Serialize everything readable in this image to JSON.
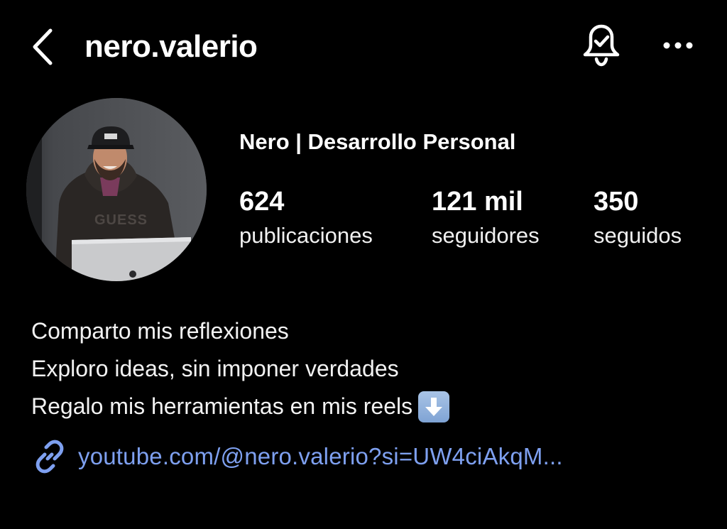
{
  "header": {
    "username": "nero.valerio",
    "back_icon": "chevron-left-icon",
    "bell_icon": "bell-check-icon",
    "more_icon": "more-horizontal-icon"
  },
  "profile": {
    "display_name": "Nero | Desarrollo Personal",
    "avatar_icon": "profile-avatar"
  },
  "stats": [
    {
      "value": "624",
      "label": "publicaciones"
    },
    {
      "value": "121 mil",
      "label": "seguidores"
    },
    {
      "value": "350",
      "label": "seguidos"
    }
  ],
  "bio": {
    "lines": [
      "Comparto mis reflexiones",
      "Exploro ideas, sin imponer verdades",
      "Regalo mis herramientas en mis reels"
    ],
    "emoji_icon": "down-arrow-emoji"
  },
  "link": {
    "icon": "link-icon",
    "text": "youtube.com/@nero.valerio?si=UW4ciAkqM..."
  },
  "colors": {
    "background": "#000000",
    "text": "#ffffff",
    "link": "#7ea0f0"
  }
}
